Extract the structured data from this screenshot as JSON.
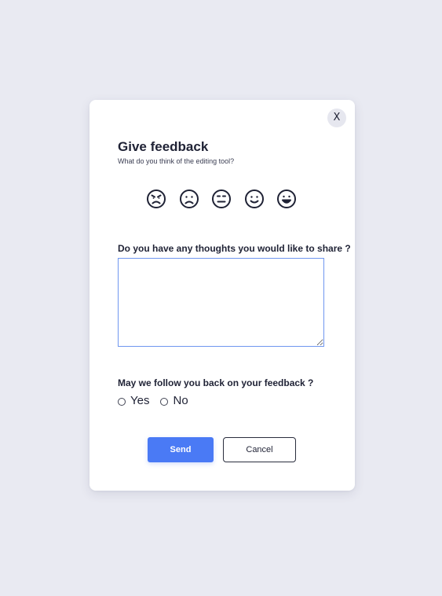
{
  "dialog": {
    "close_label": "X",
    "title": "Give feedback",
    "subtitle": "What do you think of the editing tool?",
    "ratings": [
      {
        "icon": "angry-face-icon"
      },
      {
        "icon": "sad-face-icon"
      },
      {
        "icon": "neutral-face-icon"
      },
      {
        "icon": "smiling-face-icon"
      },
      {
        "icon": "grinning-face-icon"
      }
    ],
    "thoughts_question": "Do you have any thoughts you would like to share ?",
    "thoughts_value": "",
    "follow_question": "May we follow you back on your feedback ?",
    "follow_options": {
      "yes": "Yes",
      "no": "No"
    },
    "send_label": "Send",
    "cancel_label": "Cancel"
  },
  "colors": {
    "background": "#e9eaf2",
    "accent": "#4a7af5",
    "textarea_border": "#6f96ef",
    "text": "#1f2235"
  }
}
